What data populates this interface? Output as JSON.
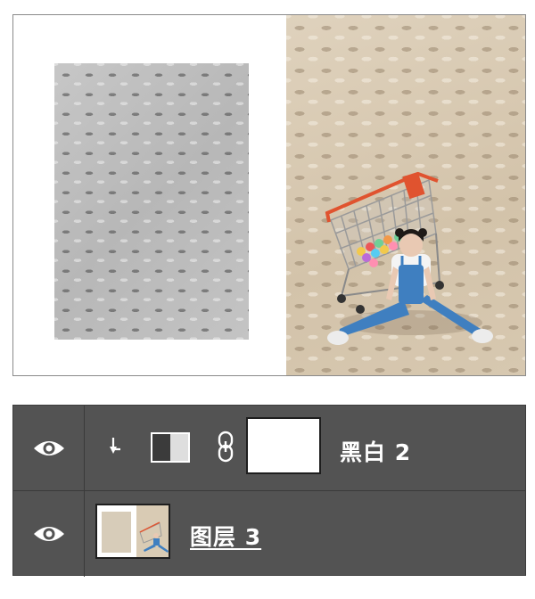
{
  "canvas": {
    "left_panel": "grayscale-pavement-crop",
    "right_panel": "color-photo-girl-with-shopping-cart"
  },
  "layers_panel": {
    "layers": [
      {
        "name": "黑白 2",
        "type": "adjustment-black-white",
        "visible": true,
        "clipped": true,
        "icons": [
          "eye-icon",
          "clip-arrow-icon",
          "black-white-adjustment-icon",
          "chain-link-icon"
        ],
        "mask": "white"
      },
      {
        "name": "图层 3",
        "type": "pixel-layer",
        "visible": true,
        "icons": [
          "eye-icon"
        ]
      }
    ]
  },
  "colors": {
    "panel_bg": "#535353",
    "divider": "#3a3a3a",
    "text": "#ffffff",
    "cart_accent": "#e0532f",
    "overalls": "#3f7fc0"
  }
}
